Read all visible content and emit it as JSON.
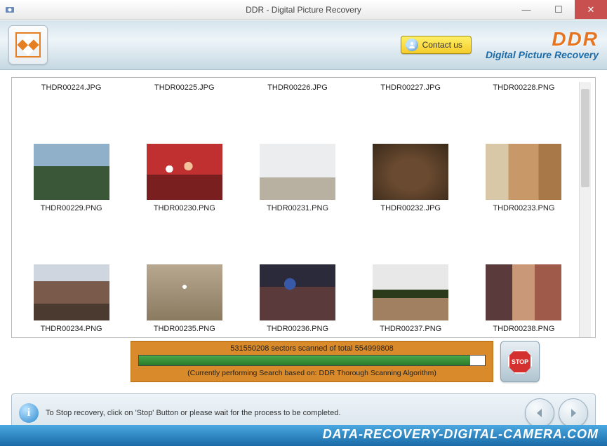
{
  "window": {
    "title": "DDR - Digital Picture Recovery"
  },
  "header": {
    "contact_label": "Contact us",
    "brand": "DDR",
    "brand_sub": "Digital Picture Recovery"
  },
  "files": {
    "top_labels": [
      "THDR00224.JPG",
      "THDR00225.JPG",
      "THDR00226.JPG",
      "THDR00227.JPG",
      "THDR00228.PNG"
    ],
    "row2": [
      "THDR00229.PNG",
      "THDR00230.PNG",
      "THDR00231.PNG",
      "THDR00232.JPG",
      "THDR00233.PNG"
    ],
    "row3": [
      "THDR00234.PNG",
      "THDR00235.PNG",
      "THDR00236.PNG",
      "THDR00237.PNG",
      "THDR00238.PNG"
    ]
  },
  "progress": {
    "scanned": 531550208,
    "total": 554999808,
    "text": "531550208 sectors scanned of total 554999808",
    "sub": "(Currently performing Search based on:  DDR Thorough Scanning Algorithm)",
    "stop_label": "STOP"
  },
  "info": {
    "text": "To Stop recovery, click on 'Stop' Button or please wait for the process to be completed."
  },
  "footer": {
    "url": "DATA-RECOVERY-DIGITAL-CAMERA.COM"
  }
}
